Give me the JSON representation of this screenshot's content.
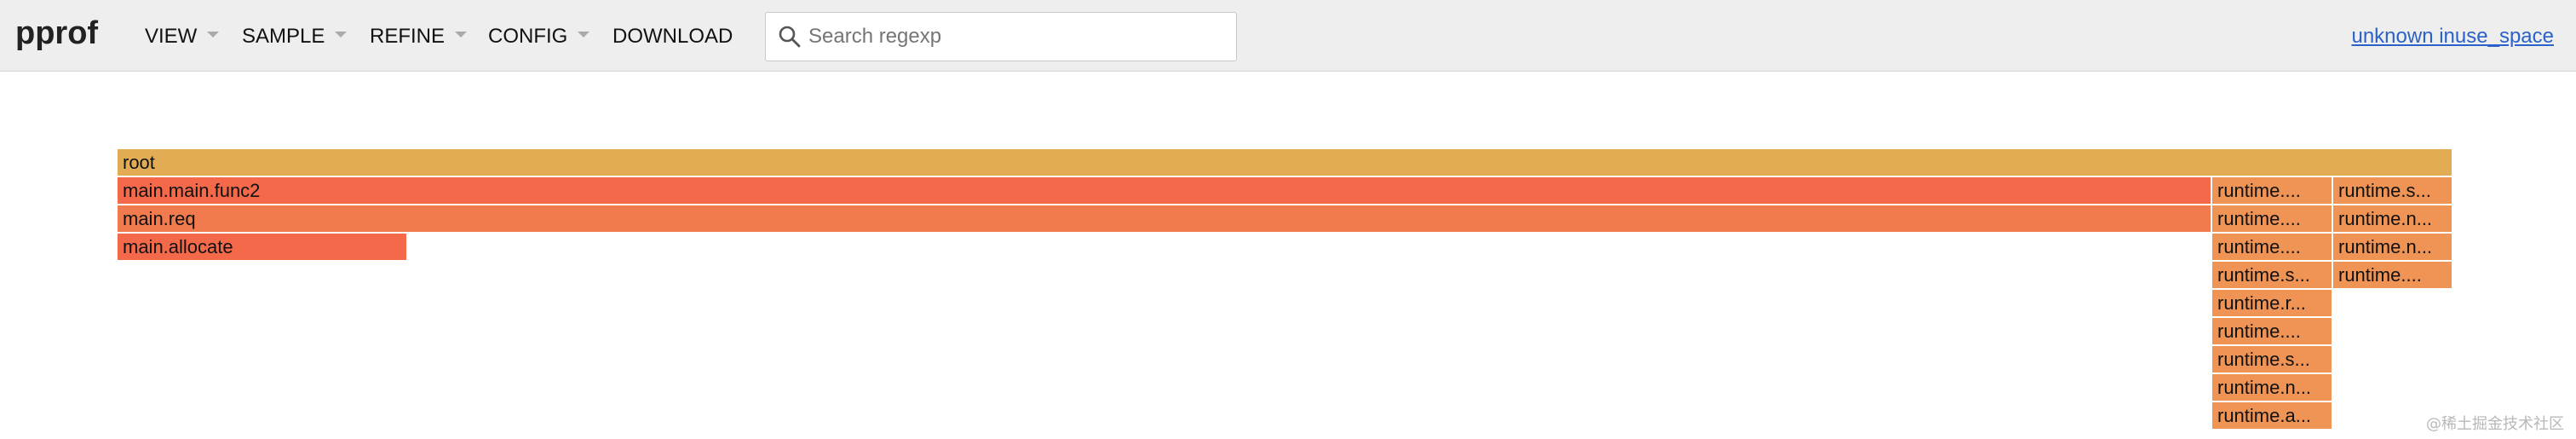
{
  "app": {
    "logo": "pprof",
    "menu": [
      {
        "label": "VIEW",
        "dropdown": true
      },
      {
        "label": "SAMPLE",
        "dropdown": true
      },
      {
        "label": "REFINE",
        "dropdown": true
      },
      {
        "label": "CONFIG",
        "dropdown": true
      },
      {
        "label": "DOWNLOAD",
        "dropdown": false
      }
    ],
    "search": {
      "placeholder": "Search regexp",
      "value": ""
    },
    "profile_link": "unknown inuse_space"
  },
  "colors": {
    "root": "#e1ac54",
    "hot": "#f4694a",
    "warm": "#f17a4e",
    "runtime": "#ef9455",
    "link": "#2a62c9"
  },
  "flamegraph": {
    "frames": [
      {
        "label": "root",
        "depth": 0,
        "col": "all",
        "color": "root"
      },
      {
        "label": "main.main.func2",
        "depth": 1,
        "col": "main",
        "color": "hot"
      },
      {
        "label": "main.req",
        "depth": 2,
        "col": "main",
        "color": "warm"
      },
      {
        "label": "main.allocate",
        "depth": 3,
        "col": "alloc",
        "color": "hot"
      },
      {
        "label": "runtime....",
        "depth": 1,
        "col": "rtA",
        "color": "runtime"
      },
      {
        "label": "runtime....",
        "depth": 2,
        "col": "rtA",
        "color": "runtime"
      },
      {
        "label": "runtime....",
        "depth": 3,
        "col": "rtA",
        "color": "runtime"
      },
      {
        "label": "runtime.s...",
        "depth": 4,
        "col": "rtA",
        "color": "runtime"
      },
      {
        "label": "runtime.r...",
        "depth": 5,
        "col": "rtA",
        "color": "runtime"
      },
      {
        "label": "runtime....",
        "depth": 6,
        "col": "rtA",
        "color": "runtime"
      },
      {
        "label": "runtime.s...",
        "depth": 7,
        "col": "rtA",
        "color": "runtime"
      },
      {
        "label": "runtime.n...",
        "depth": 8,
        "col": "rtA",
        "color": "runtime"
      },
      {
        "label": "runtime.a...",
        "depth": 9,
        "col": "rtA",
        "color": "runtime"
      },
      {
        "label": "runtime.s...",
        "depth": 1,
        "col": "rtB",
        "color": "runtime"
      },
      {
        "label": "runtime.n...",
        "depth": 2,
        "col": "rtB",
        "color": "runtime"
      },
      {
        "label": "runtime.n...",
        "depth": 3,
        "col": "rtB",
        "color": "runtime"
      },
      {
        "label": "runtime....",
        "depth": 4,
        "col": "rtB",
        "color": "runtime"
      }
    ]
  },
  "watermark": "@稀土掘金技术社区"
}
